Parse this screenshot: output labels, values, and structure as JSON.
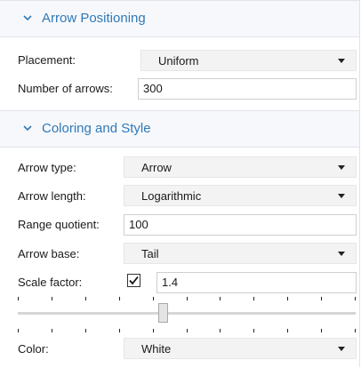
{
  "sections": [
    {
      "title": "Arrow Positioning",
      "chevron_icon": "chevron-down-icon"
    },
    {
      "title": "Coloring and Style",
      "chevron_icon": "chevron-down-icon"
    }
  ],
  "arrow_positioning": {
    "placement": {
      "label": "Placement:",
      "value": "Uniform"
    },
    "number_of_arrows": {
      "label": "Number of arrows:",
      "value": "300"
    }
  },
  "coloring_and_style": {
    "arrow_type": {
      "label": "Arrow type:",
      "value": "Arrow"
    },
    "arrow_length": {
      "label": "Arrow length:",
      "value": "Logarithmic"
    },
    "range_quotient": {
      "label": "Range quotient:",
      "value": "100"
    },
    "arrow_base": {
      "label": "Arrow base:",
      "value": "Tail"
    },
    "scale_factor": {
      "label": "Scale factor:",
      "checked": true,
      "value": "1.4",
      "slider_fraction": 0.43
    },
    "color": {
      "label": "Color:",
      "value": "White"
    }
  },
  "colors": {
    "section_title": "#2f79b8",
    "header_bg": "#f7f8fb",
    "dropdown_bg": "#f3f3f3"
  }
}
